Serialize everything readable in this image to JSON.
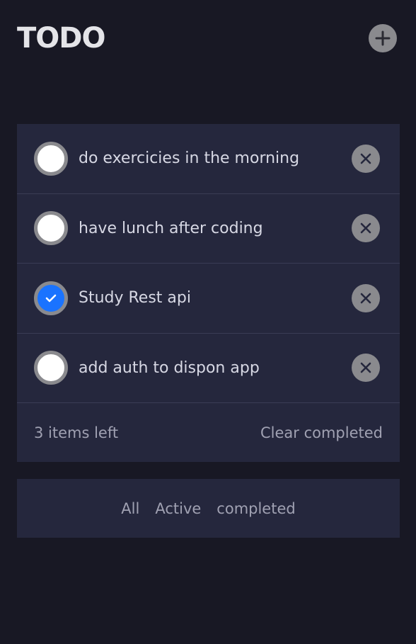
{
  "header": {
    "title": "TODO",
    "add_icon": "plus-icon"
  },
  "todos": [
    {
      "text": "do exercicies in the morning",
      "completed": false
    },
    {
      "text": "have lunch after coding",
      "completed": false
    },
    {
      "text": "Study Rest api",
      "completed": true
    },
    {
      "text": "add auth to dispon app",
      "completed": false
    }
  ],
  "footer": {
    "items_left": "3 items left",
    "clear_label": "Clear completed"
  },
  "filters": [
    {
      "label": "All"
    },
    {
      "label": "Active"
    },
    {
      "label": "completed"
    }
  ],
  "colors": {
    "background": "#181824",
    "card": "#25273d",
    "accent": "#1a73ff",
    "icon_bg": "#8a8a8e"
  }
}
